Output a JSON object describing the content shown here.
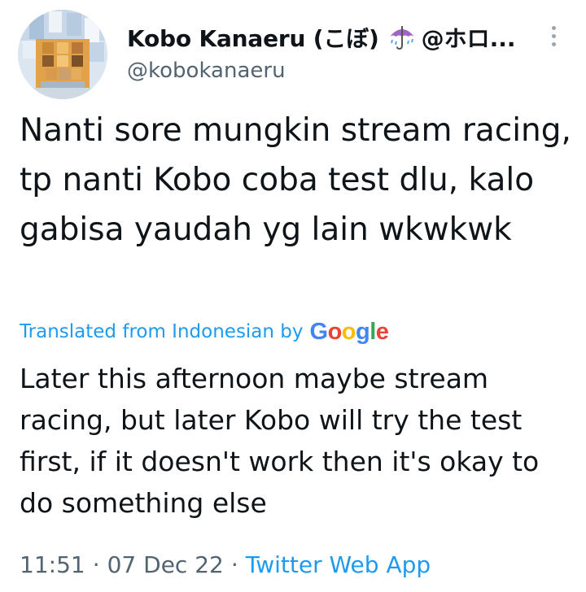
{
  "author": {
    "display_name": "Kobo Kanaeru (こぼ)",
    "name_suffix": "@ホロ...",
    "handle": "@kobokanaeru",
    "avatar_icon": "pixelated-avatar",
    "emoji_icon": "umbrella-with-rain-icon"
  },
  "more_menu_icon": "vertical-ellipsis-icon",
  "tweet": {
    "text": "Nanti sore mungkin stream racing, tp nanti Kobo coba test dlu, kalo gabisa yaudah yg lain wkwkwk",
    "translated_label": "Translated from Indonesian by",
    "translator": [
      "G",
      "o",
      "o",
      "g",
      "l",
      "e"
    ],
    "translation": "Later this afternoon maybe stream racing, but later Kobo will try the test first, if it doesn't work then it's okay to do something else"
  },
  "meta": {
    "time": "11:51",
    "separator": "·",
    "date": "07 Dec 22",
    "source": "Twitter Web App"
  },
  "colors": {
    "link": "#1d9bf0",
    "secondary_text": "#536471",
    "google_blue": "#4285f4",
    "google_red": "#ea4335",
    "google_yellow": "#fbbc05",
    "google_green": "#34a853"
  }
}
